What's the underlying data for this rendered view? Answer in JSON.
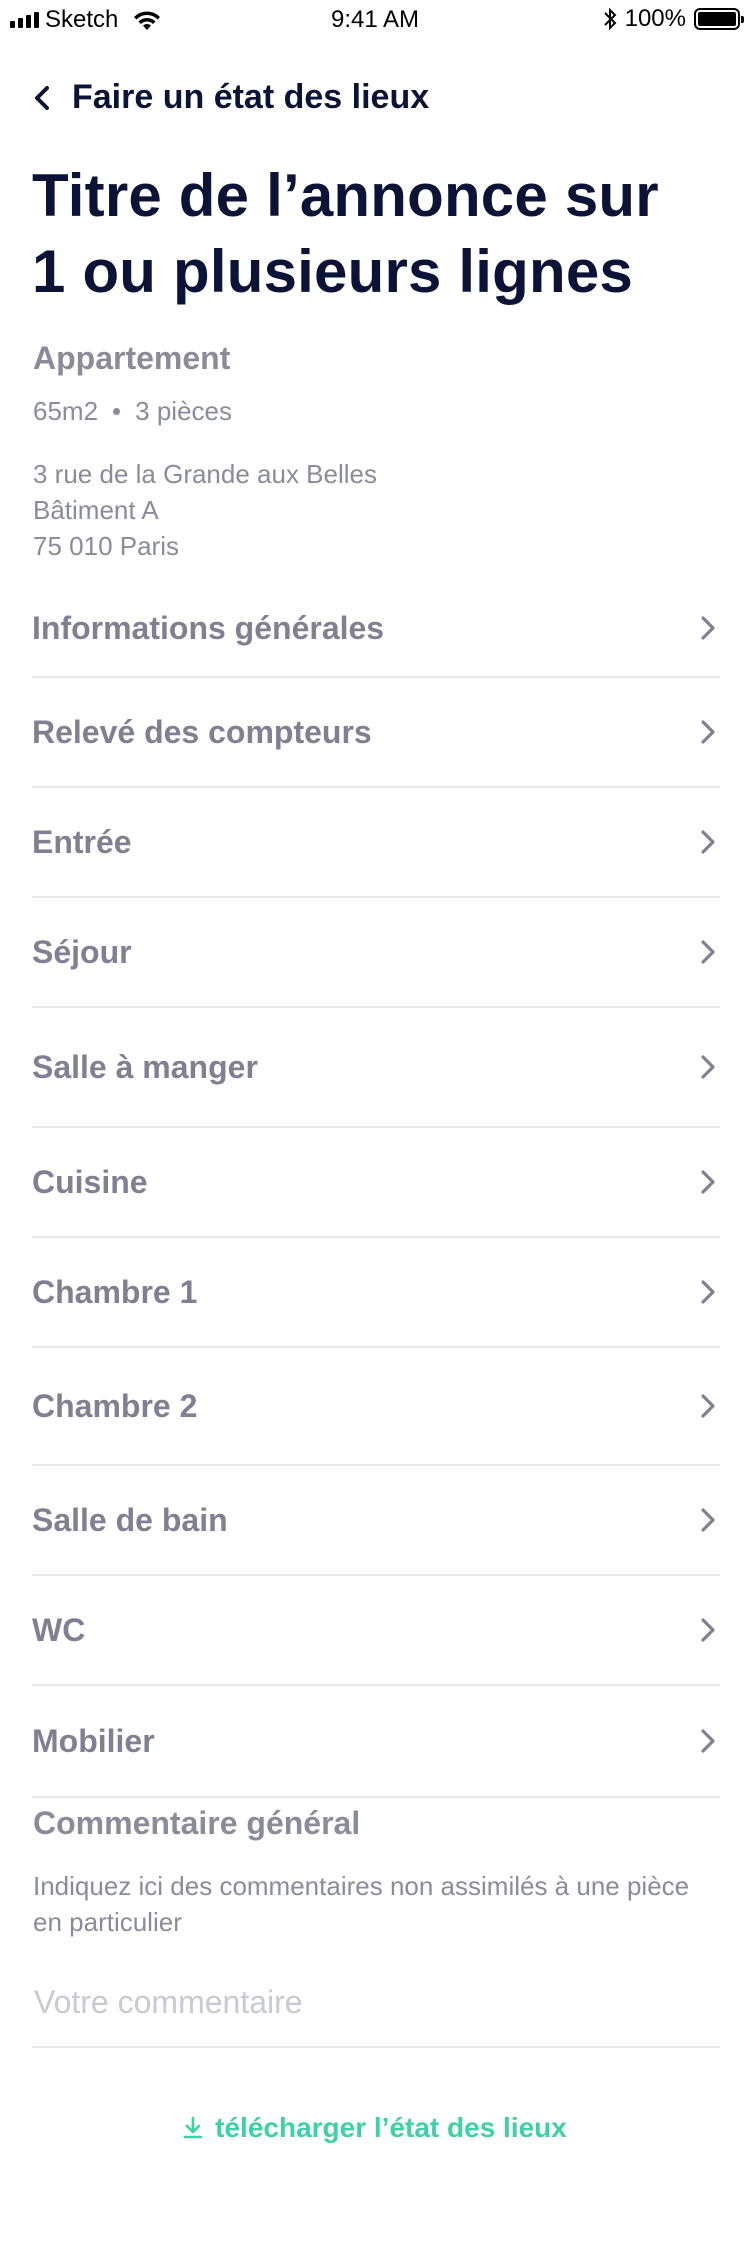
{
  "status_bar": {
    "carrier": "Sketch",
    "time": "9:41 AM",
    "battery": "100%"
  },
  "nav": {
    "back_label": "Faire un état des lieux"
  },
  "listing": {
    "title": "Titre de l’annonce sur 1 ou plusieurs lignes",
    "type": "Appartement",
    "surface": "65m2",
    "separator": "•",
    "rooms": "3 pièces",
    "address": [
      "3 rue de la Grande aux Belles",
      "Bâtiment A",
      "75 010 Paris"
    ]
  },
  "menu": [
    {
      "label": "Informations générales"
    },
    {
      "label": "Relevé des compteurs"
    },
    {
      "label": "Entrée"
    },
    {
      "label": "Séjour"
    },
    {
      "label": "Salle à manger"
    },
    {
      "label": "Cuisine"
    },
    {
      "label": "Chambre 1"
    },
    {
      "label": "Chambre 2"
    },
    {
      "label": "Salle de bain"
    },
    {
      "label": "WC"
    },
    {
      "label": "Mobilier"
    }
  ],
  "comment": {
    "title": "Commentaire général",
    "description": "Indiquez ici des commentaires non assimilés à une pièce en particulier",
    "placeholder": "Votre commentaire",
    "value": ""
  },
  "download": {
    "label": "télécharger l’état des lieux"
  },
  "colors": {
    "title": "#0b1437",
    "muted": "#8a8c9a",
    "divider": "#e6e7ea",
    "accent": "#3ed1a9"
  }
}
